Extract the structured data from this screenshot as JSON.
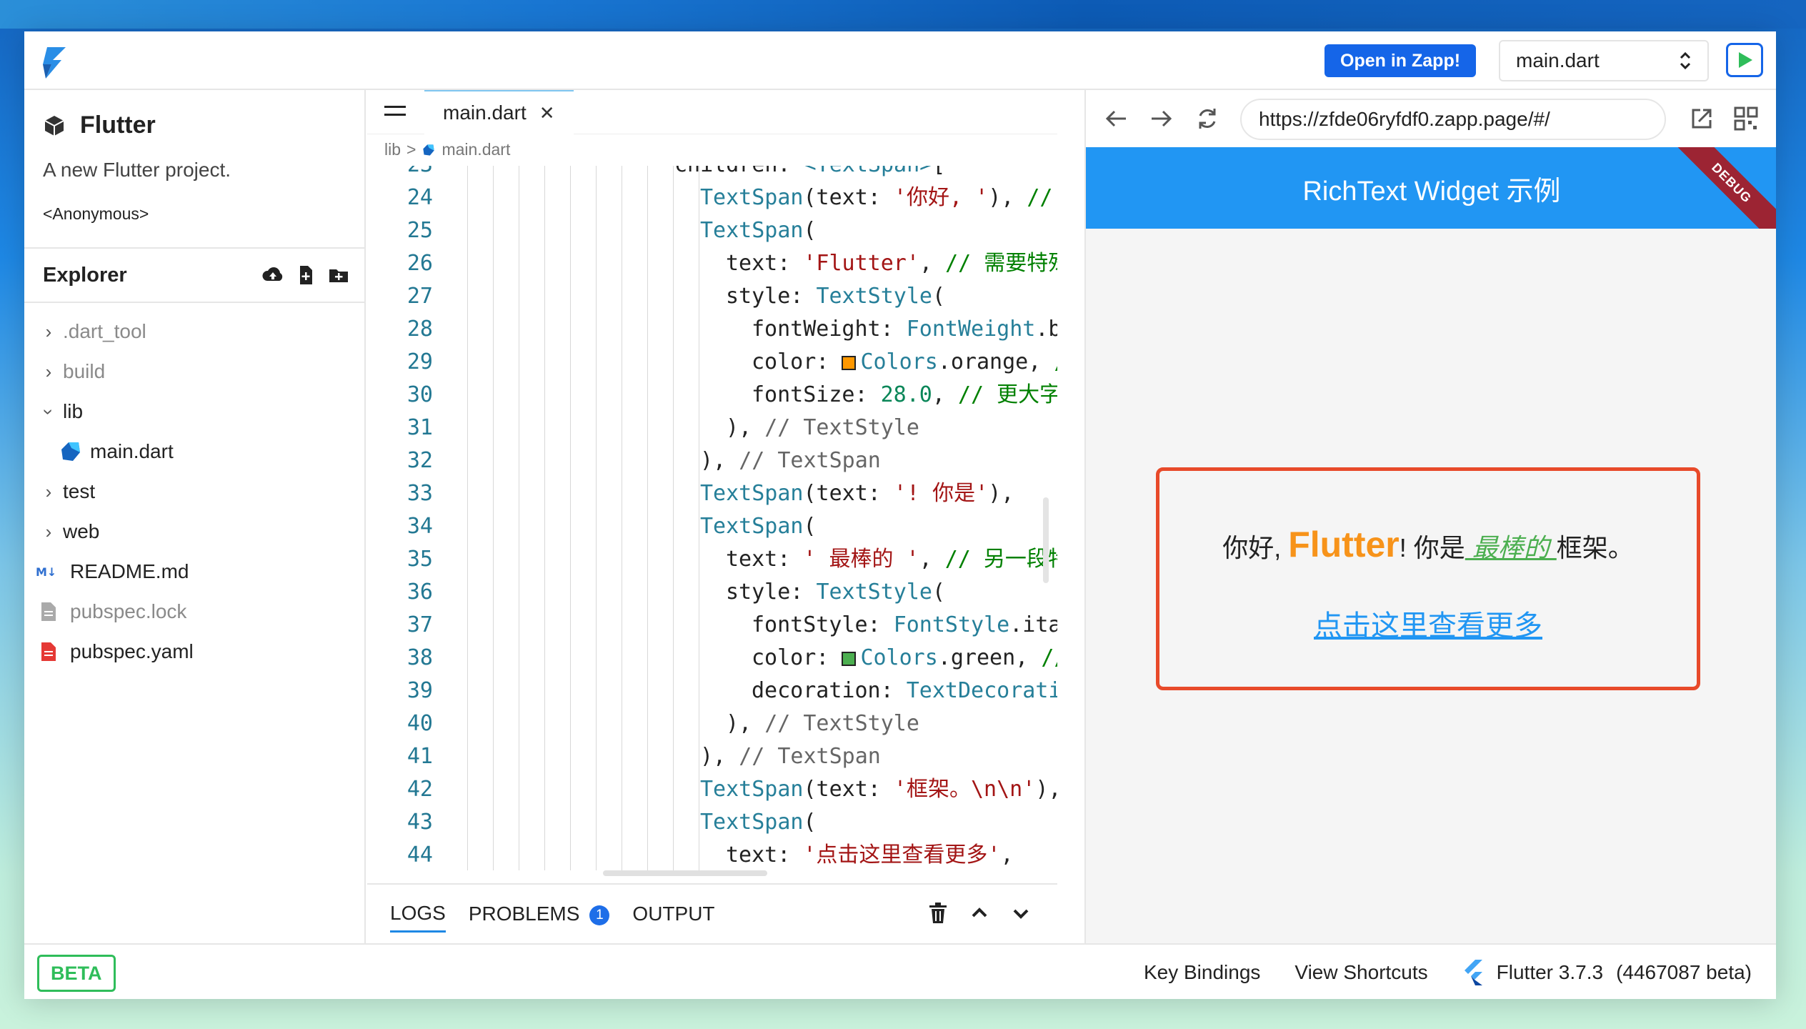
{
  "header": {
    "open_in_zapp": "Open in Zapp!",
    "file_select": "main.dart"
  },
  "sidebar": {
    "project_title": "Flutter",
    "project_desc": "A new Flutter project.",
    "project_owner": "<Anonymous>",
    "explorer_title": "Explorer",
    "tree": [
      {
        "label": ".dart_tool",
        "type": "folder",
        "expanded": false,
        "dim": true
      },
      {
        "label": "build",
        "type": "folder",
        "expanded": false,
        "dim": true
      },
      {
        "label": "lib",
        "type": "folder",
        "expanded": true,
        "dim": false
      },
      {
        "label": "main.dart",
        "type": "dart-file",
        "dim": false
      },
      {
        "label": "test",
        "type": "folder",
        "expanded": false,
        "dim": false
      },
      {
        "label": "web",
        "type": "folder",
        "expanded": false,
        "dim": false
      },
      {
        "label": "README.md",
        "type": "markdown-file",
        "dim": false
      },
      {
        "label": "pubspec.lock",
        "type": "lock-file",
        "dim": true
      },
      {
        "label": "pubspec.yaml",
        "type": "yaml-file",
        "dim": false
      }
    ]
  },
  "editor": {
    "tab_label": "main.dart",
    "breadcrumb": [
      "lib",
      ">",
      "main.dart"
    ],
    "panel_tabs": [
      "LOGS",
      "PROBLEMS",
      "OUTPUT"
    ],
    "problems_count": "1"
  },
  "preview": {
    "url": "https://zfde06ryfdf0.zapp.page/#/",
    "app_title": "RichText Widget 示例",
    "debug_banner": "DEBUG",
    "rich": {
      "part1": "你好, ",
      "flutter": "Flutter",
      "part2": "! 你是",
      "best": " 最棒的 ",
      "part3": "框架。",
      "link": "点击这里查看更多"
    }
  },
  "footer": {
    "beta": "BETA",
    "key_bindings": "Key Bindings",
    "view_shortcuts": "View Shortcuts",
    "flutter_version": "Flutter 3.7.3",
    "build": "(4467087 beta)"
  },
  "colors": {
    "accent": "#1565e8",
    "appbar": "#2196f3",
    "highlight_border": "#e84a2a",
    "beta_green": "#2fbd5a"
  }
}
